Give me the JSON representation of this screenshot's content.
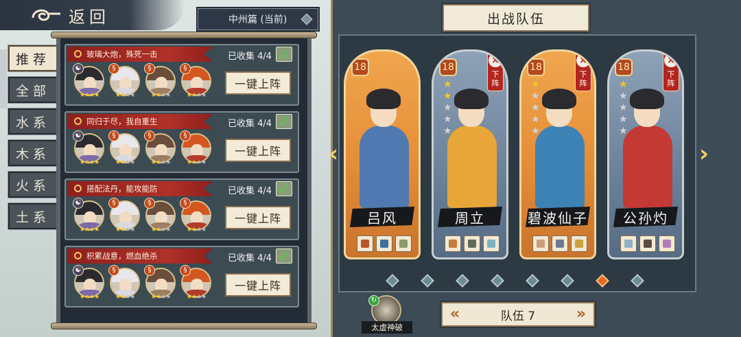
{
  "header": {
    "back_label": "返回",
    "chapter_label": "中州篇 (当前)"
  },
  "tabs": [
    {
      "label": "推荐",
      "active": true
    },
    {
      "label": "全部",
      "active": false
    },
    {
      "label": "水系",
      "active": false
    },
    {
      "label": "木系",
      "active": false
    },
    {
      "label": "火系",
      "active": false
    },
    {
      "label": "土系",
      "active": false
    }
  ],
  "lineups": [
    {
      "title": "玻璃大炮，殊死一击",
      "collected": "已收集 4/4",
      "deploy_label": "一键上阵",
      "heroes": [
        {
          "element": "dao",
          "stars": 4
        },
        {
          "element": "fire",
          "stars": 2
        },
        {
          "element": "fire",
          "stars": 2
        },
        {
          "element": "fire",
          "stars": 2
        }
      ]
    },
    {
      "title": "同归于尽，我自重生",
      "collected": "已收集 4/4",
      "deploy_label": "一键上阵",
      "heroes": [
        {
          "element": "dao",
          "stars": 4
        },
        {
          "element": "fire",
          "stars": 2
        },
        {
          "element": "fire",
          "stars": 2
        },
        {
          "element": "fire",
          "stars": 2
        }
      ]
    },
    {
      "title": "搭配法丹，能攻能防",
      "collected": "已收集 4/4",
      "deploy_label": "一键上阵",
      "heroes": [
        {
          "element": "dao",
          "stars": 4
        },
        {
          "element": "fire",
          "stars": 2
        },
        {
          "element": "fire",
          "stars": 2
        },
        {
          "element": "fire",
          "stars": 2
        }
      ]
    },
    {
      "title": "积累战意，燃血绝杀",
      "collected": "已收集 4/4",
      "deploy_label": "一键上阵",
      "heroes": [
        {
          "element": "dao",
          "stars": 4
        },
        {
          "element": "fire",
          "stars": 2
        },
        {
          "element": "fire",
          "stars": 2
        },
        {
          "element": "fire",
          "stars": 2
        }
      ]
    }
  ],
  "team": {
    "title": "出战队伍",
    "team_label": "队伍 7",
    "skill_name": "太虚神破",
    "page_count": 8,
    "active_page": 7,
    "members": [
      {
        "name": "吕风",
        "level": "18",
        "stars": 0,
        "removable": false,
        "frame": "gold",
        "remove_label": ""
      },
      {
        "name": "周立",
        "level": "18",
        "stars": 2,
        "removable": true,
        "frame": "blue",
        "remove_label": "下阵"
      },
      {
        "name": "碧波仙子",
        "level": "18",
        "stars": 1,
        "removable": true,
        "frame": "gold",
        "remove_label": "下阵"
      },
      {
        "name": "公孙灼",
        "level": "18",
        "stars": 1,
        "removable": true,
        "frame": "blue",
        "remove_label": "下阵"
      }
    ]
  },
  "colors": {
    "accent_red": "#b3261e",
    "gold_frame": "#f0a64e",
    "active_dot": "#e36a1d"
  }
}
